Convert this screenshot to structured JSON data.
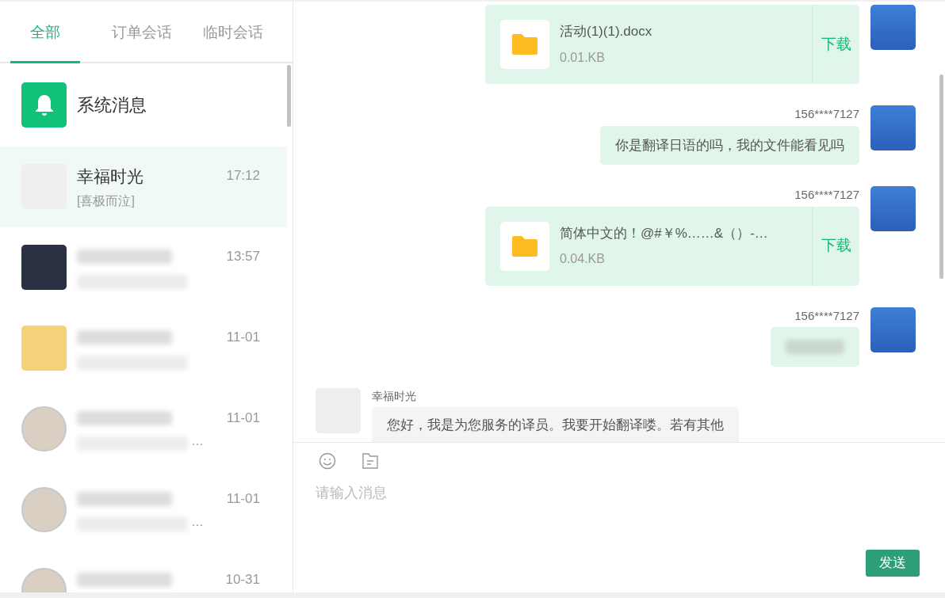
{
  "tabs": [
    {
      "label": "全部",
      "selected": true
    },
    {
      "label": "订单会话",
      "selected": false
    },
    {
      "label": "临时会话",
      "selected": false
    }
  ],
  "system_item": {
    "label": "系统消息"
  },
  "conversations": [
    {
      "name": "幸福时光",
      "time": "17:12",
      "preview": "[喜极而泣]",
      "selected": true,
      "round_avatar": false,
      "redacted": false
    },
    {
      "time": "13:57",
      "selected": false,
      "round_avatar": false,
      "redacted": true
    },
    {
      "time": "11-01",
      "selected": false,
      "round_avatar": false,
      "redacted": true
    },
    {
      "time": "11-01",
      "preview": "…",
      "selected": false,
      "round_avatar": true,
      "redacted": true
    },
    {
      "time": "11-01",
      "preview": "…",
      "selected": false,
      "round_avatar": true,
      "redacted": true
    },
    {
      "time": "10-31",
      "selected": false,
      "round_avatar": true,
      "redacted": true
    }
  ],
  "messages": [
    {
      "kind": "file",
      "outgoing": true,
      "file_name": "活动(1)(1).docx",
      "file_size": "0.01.KB",
      "action": "下载"
    },
    {
      "kind": "text",
      "outgoing": true,
      "sender": "156****7127",
      "text": "你是翻译日语的吗，我的文件能看见吗"
    },
    {
      "kind": "file",
      "outgoing": true,
      "sender": "156****7127",
      "file_name": "简体中文的！@#￥%……&（）-…",
      "file_size": "0.04.KB",
      "action": "下载"
    },
    {
      "kind": "redacted",
      "outgoing": true,
      "sender": "156****7127"
    },
    {
      "kind": "text",
      "outgoing": false,
      "sender": "幸福时光",
      "text": "您好，我是为您服务的译员。我要开始翻译喽。若有其他"
    }
  ],
  "composer": {
    "placeholder": "请输入消息",
    "send": "发送"
  }
}
